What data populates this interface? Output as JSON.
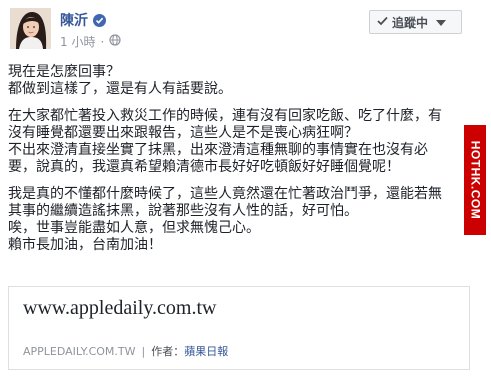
{
  "author": {
    "name": "陳沂",
    "timestamp": "1 小時",
    "follow_label": "追蹤中"
  },
  "post": {
    "paragraphs": [
      [
        "現在是怎麼回事？",
        "都做到這樣了，還是有人有話要說。"
      ],
      [
        "在大家都忙著投入救災工作的時候，連有沒有回家吃飯、吃了什麼，有",
        "沒有睡覺都還要出來跟報告，這些人是不是喪心病狂啊？",
        "不出來澄清直接坐實了抹黑，出來澄清這種無聊的事情實在也沒有必",
        "要，說真的，我還真希望賴清德市長好好吃頓飯好好睡個覺呢！"
      ],
      [
        "我是真的不懂都什麼時候了，這些人竟然還在忙著政治鬥爭，還能若無",
        "其事的繼續造謠抹黑，說著那些沒有人性的話，好可怕。",
        "唉，世事豈能盡如人意，但求無愧己心。",
        "賴市長加油，台南加油！"
      ]
    ]
  },
  "watermark": "HOTHK.COM",
  "link_card": {
    "domain_display": "www.appledaily.com.tw",
    "source": "APPLEDAILY.COM.TW",
    "author_prefix": "作者：",
    "author_name": "蘋果日報"
  },
  "icons": {
    "verified": "verified-badge-icon",
    "globe": "globe-icon",
    "follow_check": "check-icon",
    "follow_menu": "caret-down-icon"
  },
  "colors": {
    "name_link": "#365899",
    "verified": "#4267b2",
    "meta": "#90949c",
    "watermark_bg": "#cc0000"
  }
}
